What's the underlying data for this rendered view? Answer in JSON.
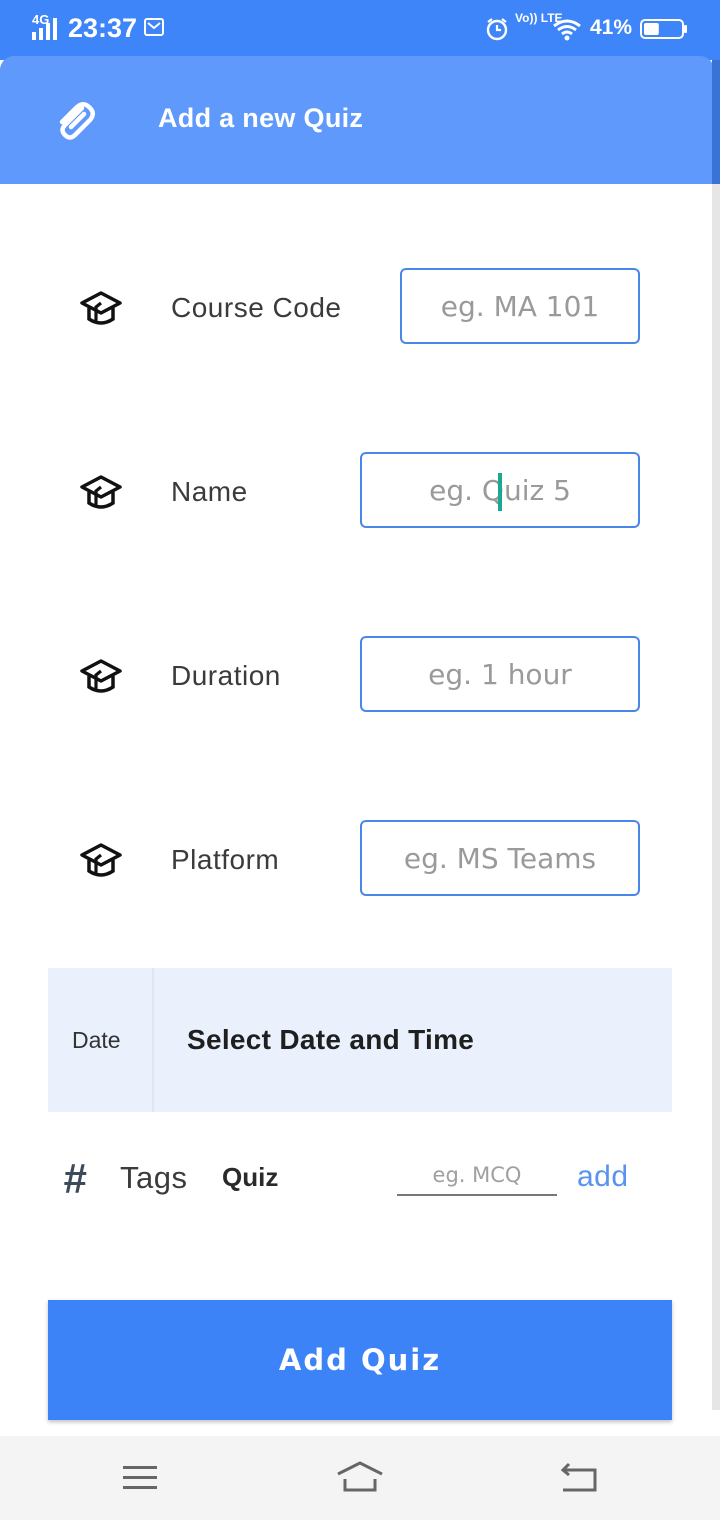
{
  "status_bar": {
    "network": "4G",
    "time": "23:37",
    "volte": "Vo)) LTE",
    "battery_percent": "41%",
    "battery_level": 0.41
  },
  "header": {
    "title": "Add a new Quiz"
  },
  "form": {
    "course_code": {
      "label": "Course Code",
      "placeholder": "eg. MA 101"
    },
    "name": {
      "label": "Name",
      "placeholder": "eg. Quiz 5"
    },
    "duration": {
      "label": "Duration",
      "placeholder": "eg. 1 hour"
    },
    "platform": {
      "label": "Platform",
      "placeholder": "eg. MS Teams"
    }
  },
  "date": {
    "label": "Date",
    "select_text": "Select Date and Time"
  },
  "tags": {
    "label": "Tags",
    "items": [
      "Quiz"
    ],
    "input_placeholder": "eg. MCQ",
    "add_label": "add"
  },
  "submit": {
    "label": "Add Quiz"
  },
  "colors": {
    "status_bar": "#3d85f8",
    "header": "#5f99fb",
    "accent": "#3d83f8",
    "field_border": "#4a86e8",
    "date_panel": "#eaf1fd"
  },
  "icons": {
    "header": "paperclip-icon",
    "row": "graduation-cap-icon",
    "tags": "hash-icon",
    "nav": [
      "menu-icon",
      "home-icon",
      "back-icon"
    ]
  }
}
